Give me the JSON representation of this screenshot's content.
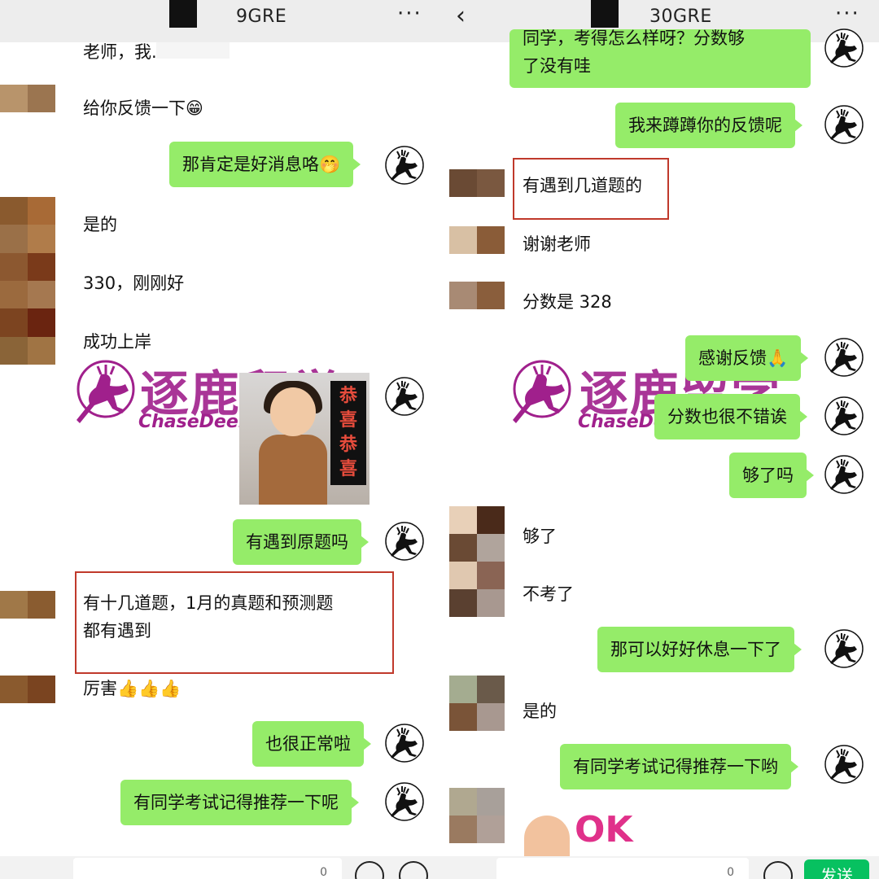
{
  "left": {
    "header": {
      "title": "9GRE",
      "more": "···"
    },
    "messages": [
      {
        "id": "l1",
        "side": "other",
        "text": "老师，我..."
      },
      {
        "id": "l2",
        "side": "other",
        "text": "给你反馈一下😁"
      },
      {
        "id": "l3",
        "side": "me",
        "text": "那肯定是好消息咯🤭"
      },
      {
        "id": "l4",
        "side": "other",
        "text": "是的"
      },
      {
        "id": "l5",
        "side": "other",
        "text": "330，刚刚好"
      },
      {
        "id": "l6",
        "side": "other",
        "text": "成功上岸"
      },
      {
        "id": "l7",
        "side": "me",
        "text": "有遇到原题吗"
      },
      {
        "id": "l8",
        "side": "other",
        "text_line1": "有十几道题，1月的真题和预测题",
        "text_line2": "都有遇到"
      },
      {
        "id": "l9",
        "side": "other",
        "text": "厉害👍👍👍"
      },
      {
        "id": "l10",
        "side": "me",
        "text": "也很正常啦"
      },
      {
        "id": "l11",
        "side": "me",
        "text": "有同学考试记得推荐一下呢"
      }
    ],
    "sticker": {
      "brand_cn": "逐鹿留学",
      "brand_en": "ChaseDeer",
      "photo_caption": [
        "恭",
        "喜",
        "恭",
        "喜"
      ]
    },
    "input": {
      "counter": "0"
    }
  },
  "right": {
    "header": {
      "back": "‹",
      "title": "30GRE",
      "more": "···"
    },
    "messages": [
      {
        "id": "r1",
        "side": "me",
        "text_line1": "同学，考得怎么样呀？分数够",
        "text_line2": "了没有哇"
      },
      {
        "id": "r2",
        "side": "me",
        "text": "我来蹲蹲你的反馈呢"
      },
      {
        "id": "r3",
        "side": "other",
        "text": "有遇到几道题的"
      },
      {
        "id": "r4",
        "side": "other",
        "text": "谢谢老师"
      },
      {
        "id": "r5",
        "side": "other",
        "text": "分数是 328"
      },
      {
        "id": "r6",
        "side": "me",
        "text": "感谢反馈🙏"
      },
      {
        "id": "r7",
        "side": "me",
        "text": "分数也很不错诶"
      },
      {
        "id": "r8",
        "side": "me",
        "text": "够了吗"
      },
      {
        "id": "r9",
        "side": "other",
        "text": "够了"
      },
      {
        "id": "r10",
        "side": "other",
        "text": "不考了"
      },
      {
        "id": "r11",
        "side": "me",
        "text": "那可以好好休息一下了"
      },
      {
        "id": "r12",
        "side": "other",
        "text": "是的"
      },
      {
        "id": "r13",
        "side": "me",
        "text": "有同学考试记得推荐一下哟"
      }
    ],
    "sticker": {
      "brand_cn": "逐鹿留学",
      "brand_en": "ChaseDeer",
      "ok_text": "OK"
    },
    "input": {
      "counter": "0",
      "send_label": "发送"
    }
  },
  "colors": {
    "bubble_me": "#95ec69",
    "send_button": "#07c160",
    "brand": "#a0208c",
    "highlight": "#c0392b"
  }
}
